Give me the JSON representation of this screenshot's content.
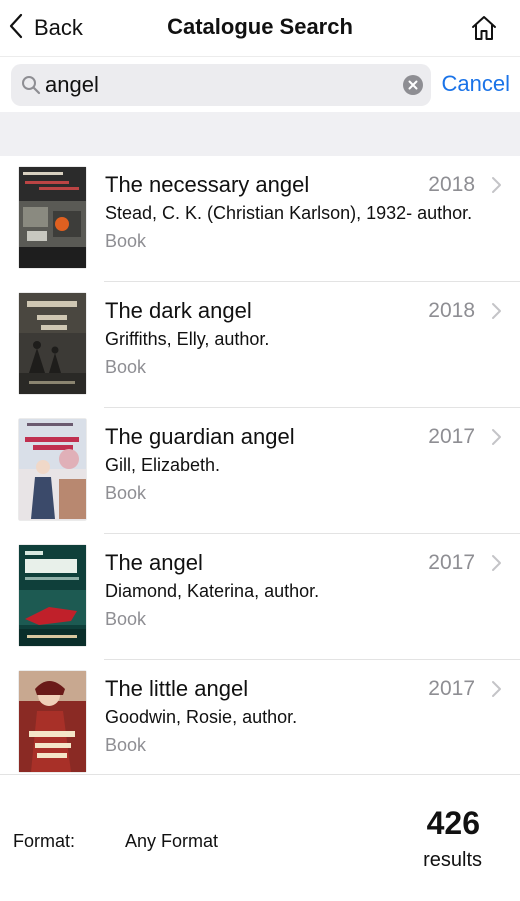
{
  "nav": {
    "back_label": "Back",
    "title": "Catalogue Search"
  },
  "search": {
    "value": "angel",
    "placeholder": "",
    "cancel_label": "Cancel"
  },
  "results": [
    {
      "title": "The necessary angel",
      "author": "Stead, C. K. (Christian Karlson), 1932- author.",
      "format": "Book",
      "year": "2018"
    },
    {
      "title": "The dark angel",
      "author": "Griffiths, Elly, author.",
      "format": "Book",
      "year": "2018"
    },
    {
      "title": "The guardian angel",
      "author": "Gill, Elizabeth.",
      "format": "Book",
      "year": "2017"
    },
    {
      "title": "The angel",
      "author": "Diamond, Katerina, author.",
      "format": "Book",
      "year": "2017"
    },
    {
      "title": "The little angel",
      "author": "Goodwin, Rosie, author.",
      "format": "Book",
      "year": "2017"
    }
  ],
  "footer": {
    "format_label": "Format:",
    "format_value": "Any Format",
    "count": "426",
    "count_label": "results"
  },
  "colors": {
    "accent": "#1a73e8",
    "secondary_text": "#8e8e93"
  }
}
